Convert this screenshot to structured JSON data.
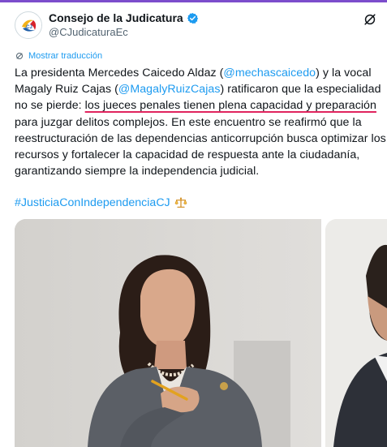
{
  "account": {
    "name": "Consejo de la Judicatura",
    "handle": "@CJudicaturaEc",
    "verified": true
  },
  "translate_label": "Mostrar traducción",
  "tweet": {
    "p1": "La presidenta Mercedes Caicedo Aldaz (",
    "m1": "@mechascaicedo",
    "p2": ") y la vocal Magaly Ruiz Cajas (",
    "m2": "@MagalyRuizCajas",
    "p3": ") ratificaron que la especialidad no se pierde: ",
    "highlight": "los jueces penales tienen plena capacidad y preparación",
    "p4": " para juzgar delitos complejos. En este encuentro se reafirmó que la reestructuración de las dependencias anticorrupción busca optimizar los recursos y fortalecer la capacidad de respuesta ante la ciudadanía, garantizando siempre la independencia judicial."
  },
  "hashtag": "#JusticiaConIndependenciaCJ",
  "icons": {
    "verified": "verified-badge-icon",
    "grok": "grok-icon",
    "translate": "translate-icon",
    "scales": "balance-scale-icon"
  },
  "colors": {
    "link": "#1d9bf0",
    "text": "#0f1419",
    "muted": "#536471",
    "underline": "#e0245e",
    "topbar": "#7c4dcc"
  }
}
